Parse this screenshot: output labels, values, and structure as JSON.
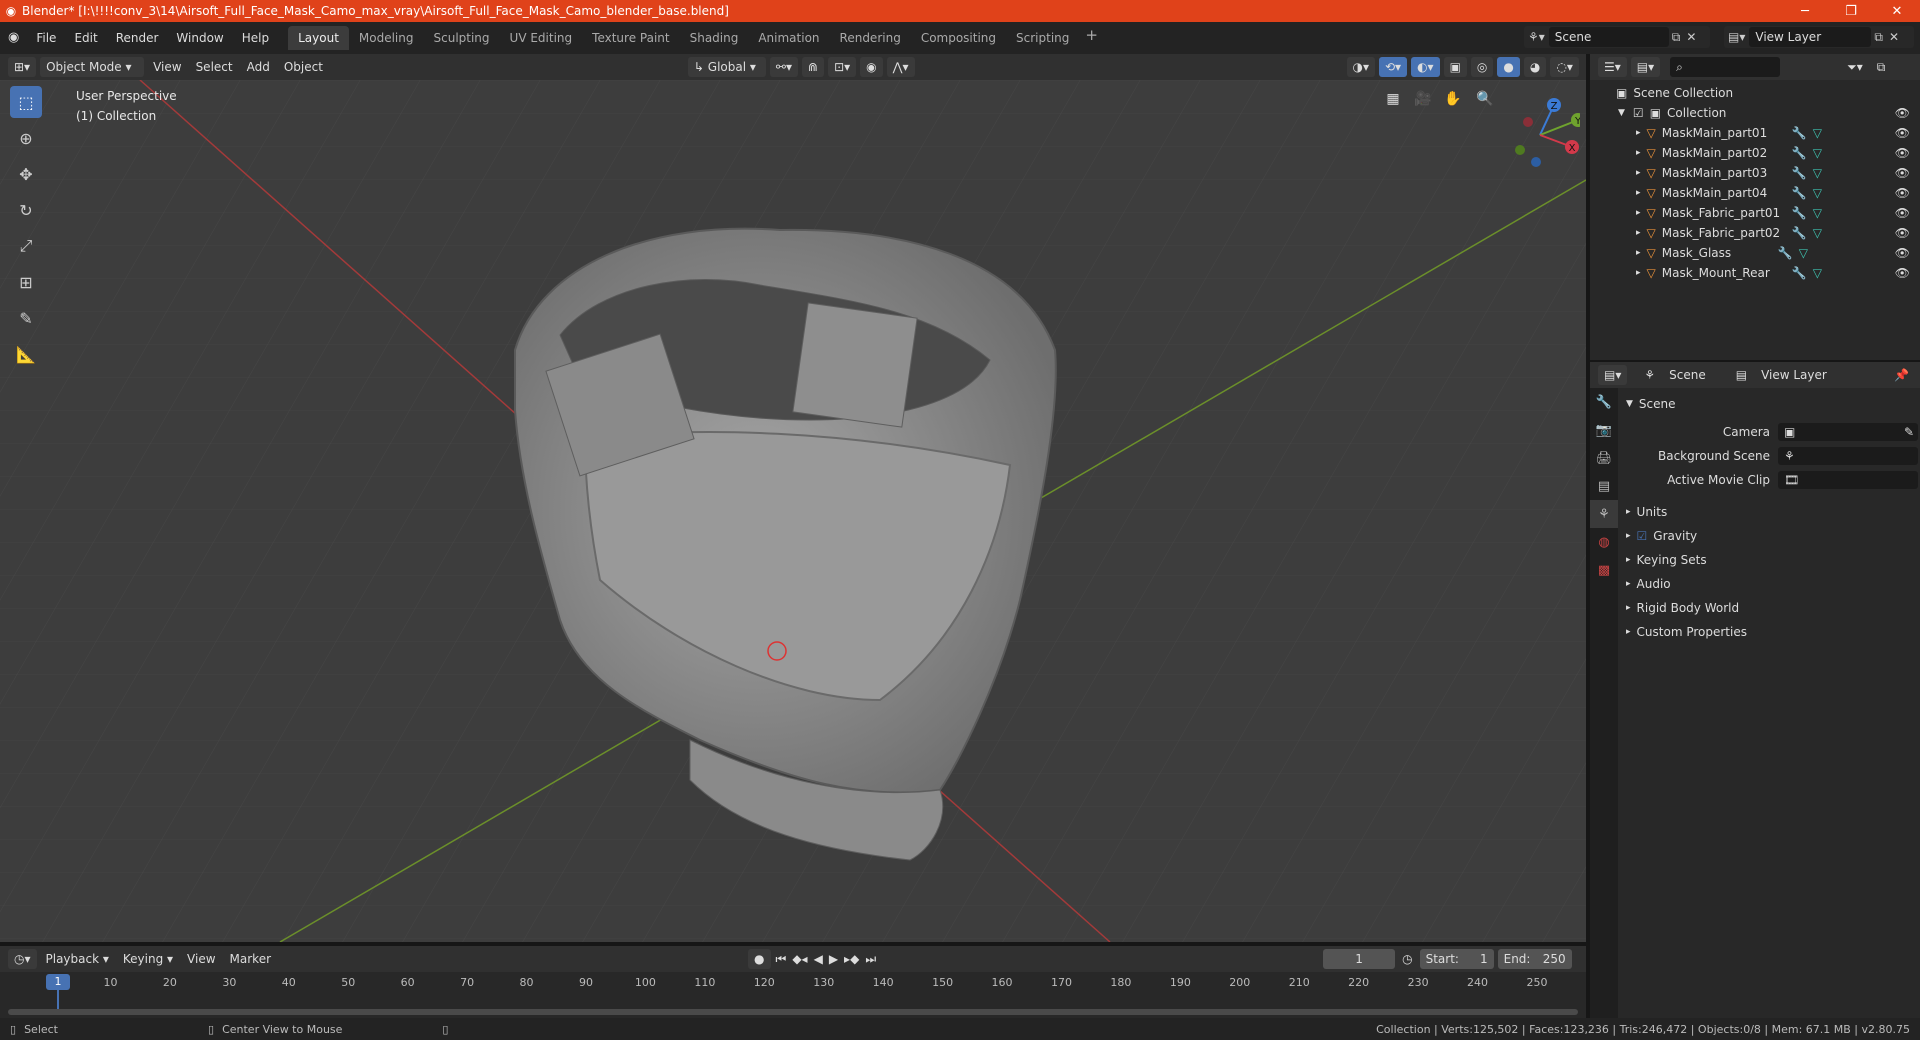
{
  "titlebar": {
    "title": "Blender* [I:\\!!!!conv_3\\14\\Airsoft_Full_Face_Mask_Camo_max_vray\\Airsoft_Full_Face_Mask_Camo_blender_base.blend]",
    "minimize": "─",
    "restore": "❐",
    "close": "✕"
  },
  "menu": {
    "file": "File",
    "edit": "Edit",
    "render": "Render",
    "window": "Window",
    "help": "Help"
  },
  "workspaces": [
    "Layout",
    "Modeling",
    "Sculpting",
    "UV Editing",
    "Texture Paint",
    "Shading",
    "Animation",
    "Rendering",
    "Compositing",
    "Scripting"
  ],
  "topright": {
    "scene": "Scene",
    "view_layer": "View Layer"
  },
  "viewport_header": {
    "mode": "Object Mode",
    "view": "View",
    "select": "Select",
    "add": "Add",
    "object": "Object",
    "orientation": "Global"
  },
  "viewport": {
    "perspective": "User Perspective",
    "collection": "(1) Collection"
  },
  "gizmo": {
    "z": "Z",
    "y": "Y",
    "x": "X"
  },
  "outliner": {
    "scene_collection": "Scene Collection",
    "collection": "Collection",
    "objects": [
      "MaskMain_part01",
      "MaskMain_part02",
      "MaskMain_part03",
      "MaskMain_part04",
      "Mask_Fabric_part01",
      "Mask_Fabric_part02",
      "Mask_Glass",
      "Mask_Mount_Rear"
    ]
  },
  "props_header": {
    "scene": "Scene",
    "view_layer": "View Layer"
  },
  "props": {
    "section": "Scene",
    "camera_label": "Camera",
    "bg_scene_label": "Background Scene",
    "movie_clip_label": "Active Movie Clip",
    "subsections": [
      "Units",
      "Gravity",
      "Keying Sets",
      "Audio",
      "Rigid Body World",
      "Custom Properties"
    ]
  },
  "timeline_header": {
    "playback": "Playback",
    "keying": "Keying",
    "view": "View",
    "marker": "Marker",
    "current_frame": "1",
    "start_label": "Start:",
    "start": "1",
    "end_label": "End:",
    "end": "250"
  },
  "timeline": {
    "current": "1",
    "ticks": [
      "10",
      "20",
      "30",
      "40",
      "50",
      "60",
      "70",
      "80",
      "90",
      "100",
      "110",
      "120",
      "130",
      "140",
      "150",
      "160",
      "170",
      "180",
      "190",
      "200",
      "210",
      "220",
      "230",
      "240",
      "250"
    ]
  },
  "status": {
    "select": "Select",
    "center_view": "Center View to Mouse",
    "stats": "Collection | Verts:125,502 | Faces:123,236 | Tris:246,472 | Objects:0/8 | Mem: 67.1 MB | v2.80.75"
  }
}
